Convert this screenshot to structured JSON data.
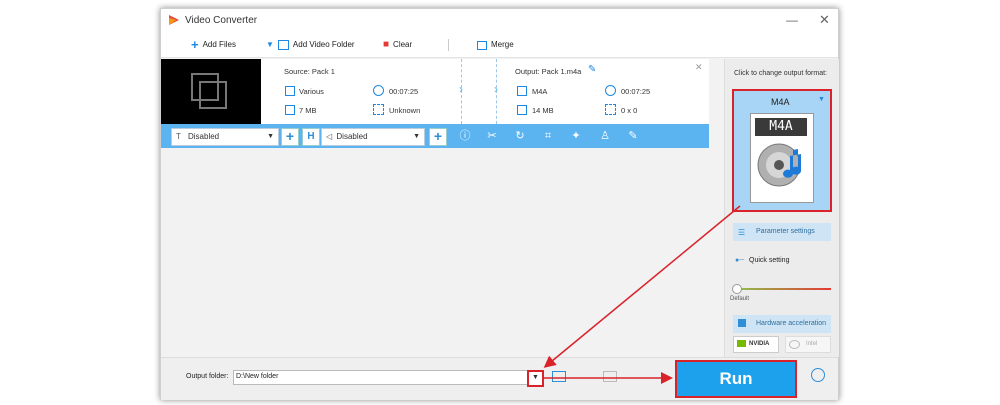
{
  "window": {
    "title": "Video Converter",
    "min_icon": "minimize-icon",
    "close_icon": "close-icon"
  },
  "toolbar": {
    "add_files": "Add Files",
    "add_video_folder": "Add Video Folder",
    "clear": "Clear",
    "merge": "Merge"
  },
  "file": {
    "source": "Source: Pack 1",
    "output": "Output: Pack 1.m4a",
    "src_format": "Various",
    "src_duration": "00:07:25",
    "src_size": "7 MB",
    "src_resolution": "Unknown",
    "out_format": "M4A",
    "out_duration": "00:07:25",
    "out_size": "14 MB",
    "out_resolution": "0 x 0"
  },
  "edit_bar": {
    "subtitle": "Disabled",
    "audio": "Disabled"
  },
  "right_panel": {
    "hint": "Click to change output format:",
    "format_name": "M4A",
    "format_icon_text": "M4A",
    "parameter_settings": "Parameter settings",
    "quick_setting": "Quick setting",
    "slider_default": "Default",
    "hardware_acceleration": "Hardware acceleration",
    "nvidia": "NVIDIA",
    "intel": "Intel"
  },
  "bottom": {
    "output_folder_label": "Output folder:",
    "output_folder_value": "D:\\New folder",
    "run": "Run"
  },
  "colors": {
    "accent": "#5bb4f0",
    "run_bg": "#1ea1ec",
    "highlight": "#d9222a"
  }
}
